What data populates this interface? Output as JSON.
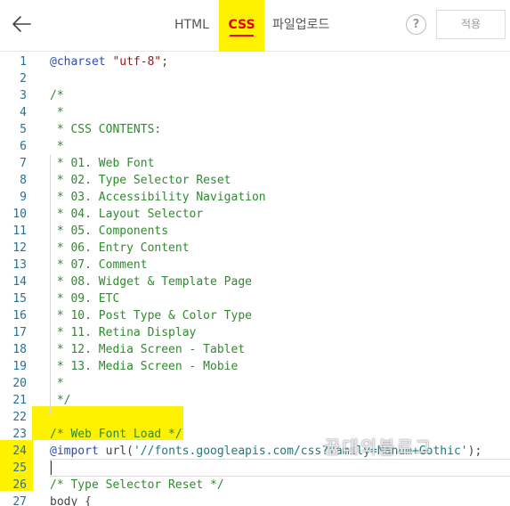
{
  "toolbar": {
    "back_icon": "arrow-left-icon",
    "tabs": [
      {
        "label": "HTML",
        "active": false
      },
      {
        "label": "CSS",
        "active": true
      },
      {
        "label": "파일업로드",
        "active": false
      }
    ],
    "help_label": "?",
    "apply_label": "적용"
  },
  "colors": {
    "active_tab_bg": "#fff200",
    "active_tab_text": "#e60012",
    "highlight": "#fff200",
    "comment": "#2e8b2e",
    "keyword": "#2a4bb5",
    "string": "#a31515",
    "line_number": "#2a6f97"
  },
  "editor": {
    "lines": [
      {
        "n": "1",
        "tokens": [
          [
            "k",
            "@charset"
          ],
          [
            "p",
            " "
          ],
          [
            "s",
            "\"utf-8\""
          ],
          [
            "p",
            ";"
          ]
        ]
      },
      {
        "n": "2",
        "tokens": []
      },
      {
        "n": "3",
        "tokens": [
          [
            "c",
            "/*"
          ]
        ]
      },
      {
        "n": "4",
        "tokens": [
          [
            "c",
            " *"
          ]
        ]
      },
      {
        "n": "5",
        "tokens": [
          [
            "c",
            " * CSS CONTENTS:"
          ]
        ]
      },
      {
        "n": "6",
        "tokens": [
          [
            "c",
            " *"
          ]
        ]
      },
      {
        "n": "7",
        "tokens": [
          [
            "c",
            " * 01. Web Font"
          ]
        ]
      },
      {
        "n": "8",
        "tokens": [
          [
            "c",
            " * 02. Type Selector Reset"
          ]
        ]
      },
      {
        "n": "9",
        "tokens": [
          [
            "c",
            " * 03. Accessibility Navigation"
          ]
        ]
      },
      {
        "n": "10",
        "tokens": [
          [
            "c",
            " * 04. Layout Selector"
          ]
        ]
      },
      {
        "n": "11",
        "tokens": [
          [
            "c",
            " * 05. Components"
          ]
        ]
      },
      {
        "n": "12",
        "tokens": [
          [
            "c",
            " * 06. Entry Content"
          ]
        ]
      },
      {
        "n": "13",
        "tokens": [
          [
            "c",
            " * 07. Comment"
          ]
        ]
      },
      {
        "n": "14",
        "tokens": [
          [
            "c",
            " * 08. Widget & Template Page"
          ]
        ]
      },
      {
        "n": "15",
        "tokens": [
          [
            "c",
            " * 09. ETC"
          ]
        ]
      },
      {
        "n": "16",
        "tokens": [
          [
            "c",
            " * 10. Post Type & Color Type"
          ]
        ]
      },
      {
        "n": "17",
        "tokens": [
          [
            "c",
            " * 11. Retina Display"
          ]
        ]
      },
      {
        "n": "18",
        "tokens": [
          [
            "c",
            " * 12. Media Screen - Tablet"
          ]
        ]
      },
      {
        "n": "19",
        "tokens": [
          [
            "c",
            " * 13. Media Screen - Mobie"
          ]
        ]
      },
      {
        "n": "20",
        "tokens": [
          [
            "c",
            " *"
          ]
        ]
      },
      {
        "n": "21",
        "tokens": [
          [
            "c",
            " */"
          ]
        ]
      },
      {
        "n": "22",
        "tokens": []
      },
      {
        "n": "23",
        "tokens": [
          [
            "c",
            "/* Web Font Load */"
          ]
        ]
      },
      {
        "n": "24",
        "tokens": [
          [
            "k",
            "@import"
          ],
          [
            "p",
            " url("
          ],
          [
            "u",
            "'//fonts.googleapis.com/css?family=Nanum+Gothic'"
          ],
          [
            "p",
            ");"
          ]
        ]
      },
      {
        "n": "25",
        "tokens": []
      },
      {
        "n": "26",
        "tokens": [
          [
            "c",
            "/* Type Selector Reset */"
          ]
        ]
      },
      {
        "n": "27",
        "tokens": [
          [
            "p",
            "body {"
          ]
        ]
      }
    ]
  },
  "watermark": "꿈대의블로그"
}
